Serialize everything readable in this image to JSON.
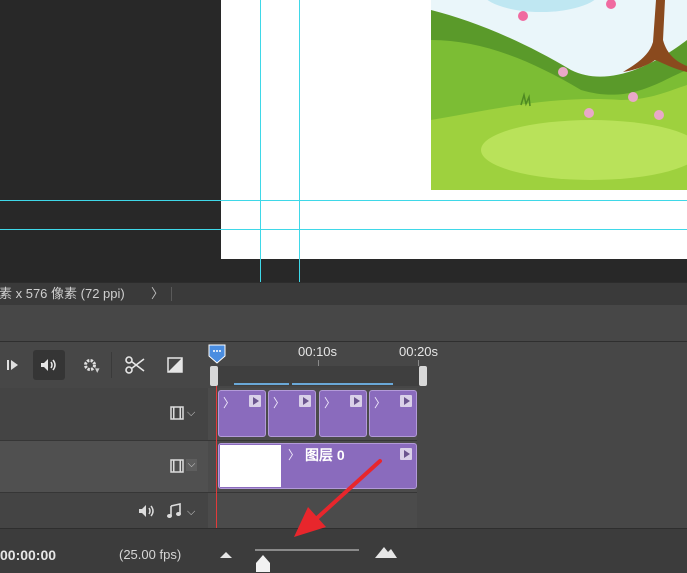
{
  "status_bar": {
    "doc_info": "素 x 576 像素 (72 ppi)",
    "arrow": "〉"
  },
  "timeline": {
    "ruler_labels": [
      "00:10s",
      "00:20s"
    ],
    "clip_chevron": "〉",
    "layer_clip_label": "图层 0",
    "current_time": "00:00:00",
    "fps": "(25.00 fps)"
  },
  "colors": {
    "canvas_bg": "#282828",
    "guide": "#3fd8e8",
    "clip_purple": "#8a6bbd",
    "playhead": "#e23a3a",
    "annotation_arrow": "#e8262c"
  },
  "icons": {
    "toolbar": [
      "step-forward-icon",
      "mute-audio-icon",
      "settings-gear-icon",
      "scissors-icon",
      "transition-icon"
    ],
    "tracks": [
      "film-strip-icon",
      "film-strip-icon",
      "speaker-icon",
      "music-note-icon"
    ],
    "footer": [
      "zoom-out-mountain-icon",
      "zoom-slider-thumb-icon",
      "zoom-in-mountain-icon"
    ]
  }
}
